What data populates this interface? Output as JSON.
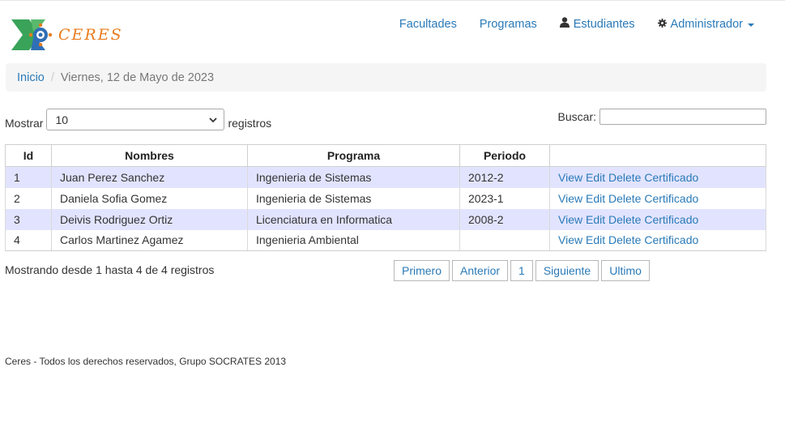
{
  "brand": {
    "name": "CERES",
    "accent": "#e87c1e",
    "logo_green": "#3aa35a",
    "logo_blue": "#2f6fb5"
  },
  "nav": {
    "items": [
      {
        "label": "Facultades",
        "icon": ""
      },
      {
        "label": "Programas",
        "icon": ""
      },
      {
        "label": "Estudiantes",
        "icon": "user-icon"
      },
      {
        "label": "Administrador",
        "icon": "gear-icon",
        "dropdown": true
      }
    ]
  },
  "breadcrumb": {
    "home": "Inicio",
    "separator": "/",
    "current": "Viernes, 12 de Mayo de 2023"
  },
  "controls": {
    "show_label": "Mostrar",
    "page_size": "10",
    "records_label": "registros",
    "search_label": "Buscar:",
    "search_value": ""
  },
  "table": {
    "columns": [
      "Id",
      "Nombres",
      "Programa",
      "Periodo",
      ""
    ],
    "rows": [
      {
        "id": "1",
        "nombres": "Juan Perez Sanchez",
        "programa": "Ingenieria de Sistemas",
        "periodo": "2012-2"
      },
      {
        "id": "2",
        "nombres": "Daniela Sofia Gomez",
        "programa": "Ingenieria de Sistemas",
        "periodo": "2023-1"
      },
      {
        "id": "3",
        "nombres": "Deivis Rodriguez Ortiz",
        "programa": "Licenciatura en Informatica",
        "periodo": "2008-2"
      },
      {
        "id": "4",
        "nombres": "Carlos Martinez Agamez",
        "programa": "Ingenieria Ambiental",
        "periodo": ""
      }
    ],
    "actions": {
      "view": "View",
      "edit": "Edit",
      "delete": "Delete",
      "cert": "Certificado"
    },
    "row_colors": {
      "odd": "#e2e4ff",
      "even": "#ffffff"
    }
  },
  "info": "Mostrando desde 1 hasta 4 de 4 registros",
  "pagination": {
    "first": "Primero",
    "prev": "Anterior",
    "page": "1",
    "next": "Siguiente",
    "last": "Ultimo"
  },
  "footer": "Ceres - Todos los derechos reservados, Grupo SOCRATES 2013",
  "link_color": "#2a7ab8"
}
